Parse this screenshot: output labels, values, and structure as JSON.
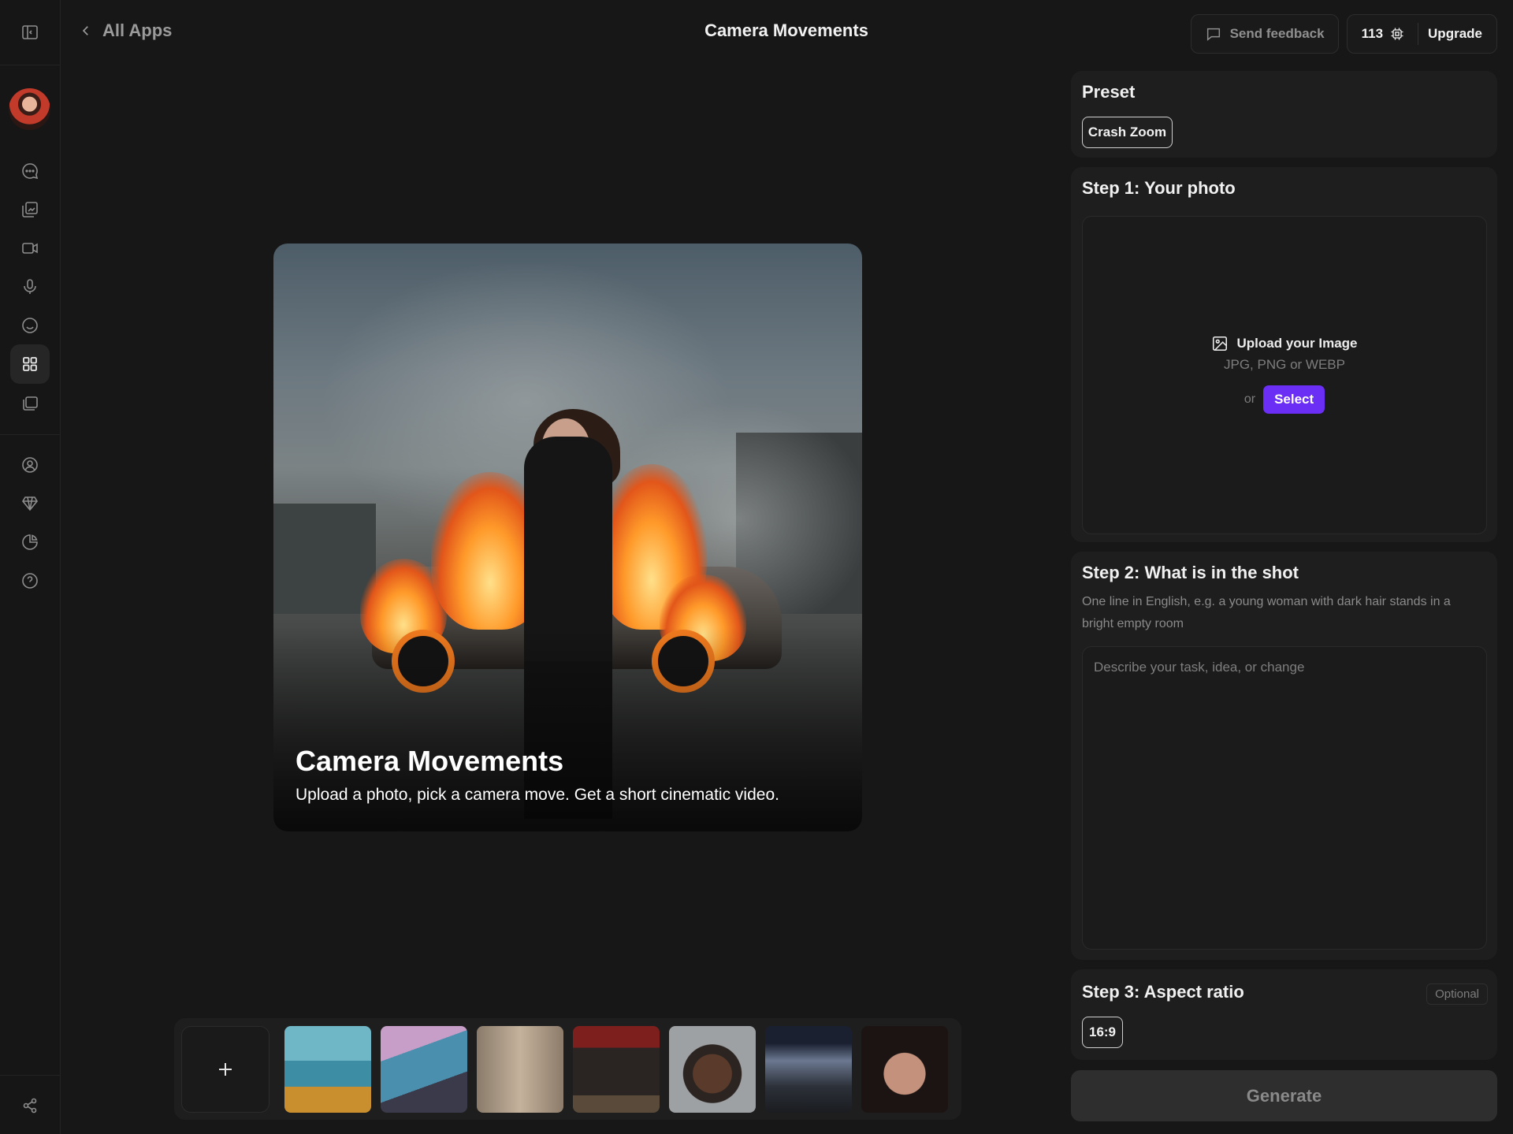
{
  "header": {
    "back_label": "All Apps",
    "title": "Camera Movements",
    "feedback_label": "Send feedback",
    "credits": "113",
    "upgrade_label": "Upgrade"
  },
  "sidebar": {
    "items": [
      {
        "icon": "panel-toggle-icon"
      },
      {
        "icon": "avatar"
      },
      {
        "icon": "chat-icon"
      },
      {
        "icon": "image-edit-icon"
      },
      {
        "icon": "video-camera-icon"
      },
      {
        "icon": "microphone-icon"
      },
      {
        "icon": "smile-icon"
      },
      {
        "icon": "apps-grid-icon",
        "active": true
      },
      {
        "icon": "gallery-icon"
      },
      {
        "icon": "profile-icon"
      },
      {
        "icon": "diamond-icon"
      },
      {
        "icon": "usage-chart-icon"
      },
      {
        "icon": "help-icon"
      },
      {
        "icon": "share-icon"
      }
    ]
  },
  "hero": {
    "title": "Camera Movements",
    "subtitle": "Upload a photo, pick a camera move. Get a short cinematic video."
  },
  "thumbnails": {
    "add_label": "+",
    "count": 7
  },
  "preset": {
    "title": "Preset",
    "selected": "Crash Zoom"
  },
  "step1": {
    "title": "Step 1: Your photo",
    "upload_title": "Upload your Image",
    "formats": "JPG, PNG or WEBP",
    "or": "or",
    "select_label": "Select"
  },
  "step2": {
    "title": "Step 2: What is in the shot",
    "description": "One line in English, e.g. a young woman with dark hair stands in a bright empty room",
    "placeholder": "Describe your task, idea, or change",
    "value": ""
  },
  "step3": {
    "title": "Step 3: Aspect ratio",
    "optional_label": "Optional",
    "selected": "16:9"
  },
  "generate_label": "Generate",
  "colors": {
    "background": "#171717",
    "card": "#1e1e1e",
    "accent": "#6a2ef5"
  }
}
